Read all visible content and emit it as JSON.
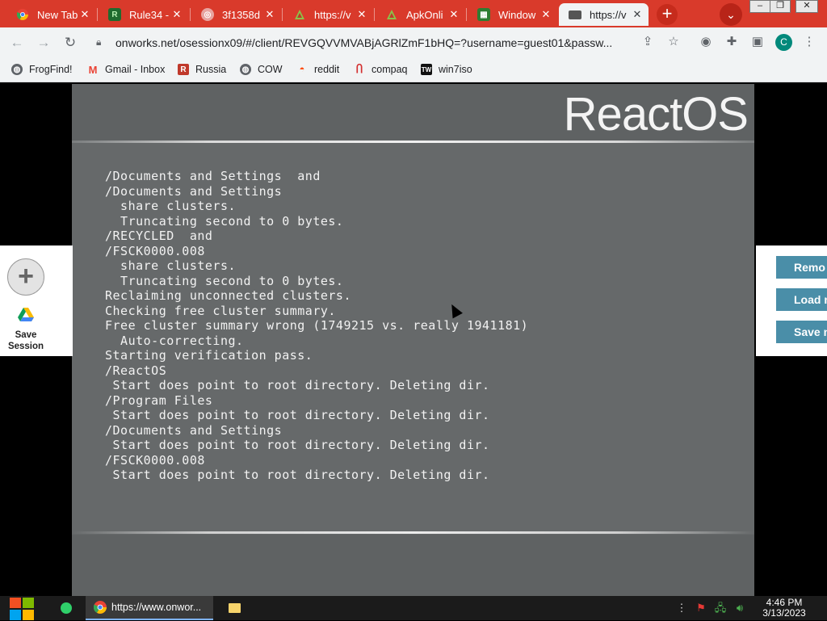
{
  "browser": {
    "tabs": [
      {
        "title": "New Tab",
        "icon": "chrome-icon",
        "active": false
      },
      {
        "title": "Rule34 -",
        "icon": "rule34-icon",
        "active": false
      },
      {
        "title": "3f1358d",
        "icon": "globe-icon",
        "active": false
      },
      {
        "title": "https://v",
        "icon": "apk-icon",
        "active": false
      },
      {
        "title": "ApkOnli",
        "icon": "apk-icon",
        "active": false
      },
      {
        "title": "Window",
        "icon": "window-icon",
        "active": false
      },
      {
        "title": "https://v",
        "icon": "screen-icon",
        "active": true
      }
    ],
    "url": "onworks.net/osessionx09/#/client/REVGQVVMVABjAGRlZmF1bHQ=?username=guest01&passw...",
    "profile_initial": "C",
    "bookmarks": [
      {
        "label": "FrogFind!",
        "icon": "globe-icon"
      },
      {
        "label": "Gmail - Inbox",
        "icon": "gmail-icon"
      },
      {
        "label": "Russia",
        "icon": "russia-icon"
      },
      {
        "label": "COW",
        "icon": "globe-icon"
      },
      {
        "label": "reddit",
        "icon": "reddit-icon"
      },
      {
        "label": "compaq",
        "icon": "compaq-icon"
      },
      {
        "label": "win7iso",
        "icon": "tw-icon"
      }
    ]
  },
  "vm": {
    "logo": "ReactOS",
    "console_lines": [
      "/Documents and Settings  and",
      "/Documents and Settings",
      "  share clusters.",
      "  Truncating second to 0 bytes.",
      "/RECYCLED  and",
      "/FSCK0000.008",
      "  share clusters.",
      "  Truncating second to 0 bytes.",
      "Reclaiming unconnected clusters.",
      "Checking free cluster summary.",
      "Free cluster summary wrong (1749215 vs. really 1941181)",
      "  Auto-correcting.",
      "Starting verification pass.",
      "/ReactOS",
      " Start does point to root directory. Deleting dir.",
      "/Program Files",
      " Start does point to root directory. Deleting dir.",
      "/Documents and Settings",
      " Start does point to root directory. Deleting dir.",
      "/FSCK0000.008",
      " Start does point to root directory. Deleting dir."
    ]
  },
  "side_left": {
    "save_session_label": "Save Session"
  },
  "side_right": {
    "buttons": [
      "Remo",
      "Load n",
      "Save n"
    ]
  },
  "taskbar": {
    "chrome_label": "https://www.onwor...",
    "time": "4:46 PM",
    "date": "3/13/2023"
  },
  "colors": {
    "tabstrip": "#d93a2b",
    "vm_background": "#66696a",
    "side_button": "#4a8ea8"
  }
}
